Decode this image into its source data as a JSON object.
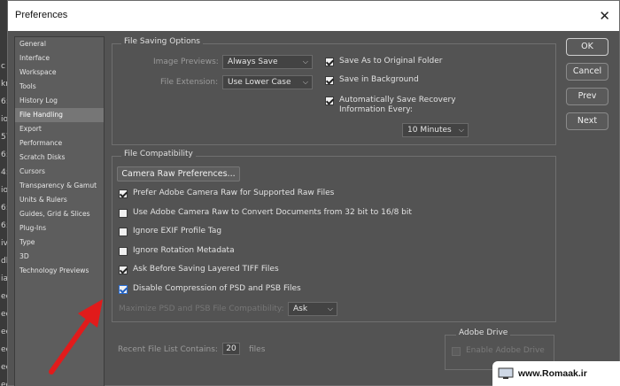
{
  "window": {
    "title": "Preferences",
    "close_glyph": "✕"
  },
  "sidebar": {
    "items": [
      {
        "label": "General"
      },
      {
        "label": "Interface"
      },
      {
        "label": "Workspace"
      },
      {
        "label": "Tools"
      },
      {
        "label": "History Log"
      },
      {
        "label": "File Handling",
        "selected": true
      },
      {
        "label": "Export"
      },
      {
        "label": "Performance"
      },
      {
        "label": "Scratch Disks"
      },
      {
        "label": "Cursors"
      },
      {
        "label": "Transparency & Gamut"
      },
      {
        "label": "Units & Rulers"
      },
      {
        "label": "Guides, Grid & Slices"
      },
      {
        "label": "Plug-Ins"
      },
      {
        "label": "Type"
      },
      {
        "label": "3D"
      },
      {
        "label": "Technology Previews"
      }
    ]
  },
  "file_saving": {
    "title": "File Saving Options",
    "image_previews_label": "Image Previews:",
    "image_previews_value": "Always Save",
    "file_extension_label": "File Extension:",
    "file_extension_value": "Use Lower Case",
    "save_as_original": "Save As to Original Folder",
    "save_in_background": "Save in Background",
    "auto_save_line1": "Automatically Save Recovery",
    "auto_save_line2": "Information Every:",
    "auto_save_interval": "10 Minutes"
  },
  "file_compat": {
    "title": "File Compatibility",
    "camera_raw_button": "Camera Raw Preferences...",
    "options": [
      {
        "label": "Prefer Adobe Camera Raw for Supported Raw Files",
        "checked": true
      },
      {
        "label": "Use Adobe Camera Raw to Convert Documents from 32 bit to 16/8 bit",
        "checked": false
      },
      {
        "label": "Ignore EXIF Profile Tag",
        "checked": false
      },
      {
        "label": "Ignore Rotation Metadata",
        "checked": false
      },
      {
        "label": "Ask Before Saving Layered TIFF Files",
        "checked": true
      },
      {
        "label": "Disable Compression of PSD and PSB Files",
        "checked": true
      }
    ],
    "maximize_label": "Maximize PSD and PSB File Compatibility:",
    "maximize_value": "Ask"
  },
  "recent": {
    "label": "Recent File List Contains:",
    "value": "20",
    "suffix": "files"
  },
  "adobe_drive": {
    "title": "Adobe Drive",
    "enable_label": "Enable Adobe Drive"
  },
  "buttons": {
    "ok": "OK",
    "cancel": "Cancel",
    "prev": "Prev",
    "next": "Next"
  },
  "left_edge_fragments": [
    "c",
    "kr",
    "6:",
    "io",
    "57",
    "6:",
    "4:",
    "io",
    "6:",
    "6:",
    "iv",
    "dl",
    "ia",
    "ee",
    "ee",
    "ee",
    "ee",
    "ee",
    "ee"
  ],
  "watermark": {
    "text": "www.Romaak.ir"
  },
  "colors": {
    "window_bg": "#535353",
    "selected_item": "#767676",
    "annotation_arrow": "#e11b1b",
    "checkbox_focus": "#2a6fd6"
  },
  "chevron": "⌵"
}
